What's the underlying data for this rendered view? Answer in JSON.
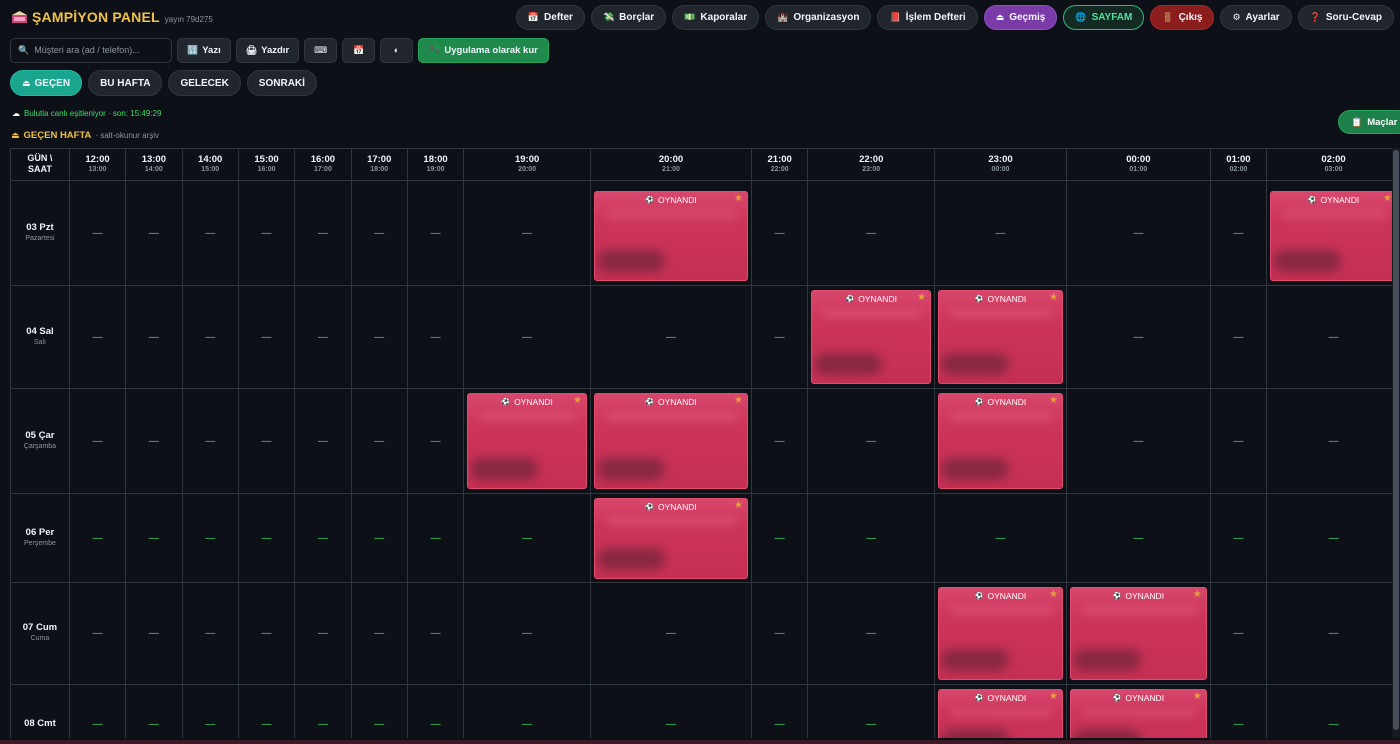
{
  "brand": {
    "title": "ŞAMPİYON PANEL",
    "version": "yayın 79d275"
  },
  "nav": [
    {
      "label": "Defter",
      "icon": "calendar-icon"
    },
    {
      "label": "Borçlar",
      "icon": "money-wings-icon"
    },
    {
      "label": "Kaporalar",
      "icon": "banknote-icon"
    },
    {
      "label": "Organizasyon",
      "icon": "castle-icon"
    },
    {
      "label": "İşlem Defteri",
      "icon": "notebook-icon"
    },
    {
      "label": "Geçmiş",
      "icon": "eject-icon",
      "accent": "#7a3aa8"
    },
    {
      "label": "SAYFAM",
      "icon": "globe-icon",
      "accent": "#2fb87a"
    },
    {
      "label": "Çıkış",
      "icon": "door-icon",
      "accent": "#8b1d1d"
    },
    {
      "label": "Ayarlar",
      "icon": "gear-icon"
    },
    {
      "label": "Soru-Cevap",
      "icon": "question-icon"
    }
  ],
  "toolbar": {
    "search_placeholder": "Müşteri ara (ad / telefon)...",
    "buttons": [
      {
        "label": "Yazı",
        "icon": "numbers-icon"
      },
      {
        "label": "Yazdır",
        "icon": "printer-icon"
      },
      {
        "label": "",
        "icon": "keyboard-icon"
      },
      {
        "label": "",
        "icon": "calendar-icon"
      },
      {
        "label": "",
        "icon": "theme-half-icon"
      }
    ],
    "install_label": "Uygulama olarak kur"
  },
  "week_tabs": [
    {
      "label": "GEÇEN",
      "icon": "eject-icon",
      "active": true
    },
    {
      "label": "BU HAFTA",
      "active": false
    },
    {
      "label": "GELECEK",
      "active": false
    },
    {
      "label": "SONRAKİ",
      "active": false
    }
  ],
  "sync_status": "Bulutla canlı eşitleniyor · son: 15:49:29",
  "archive": {
    "title": "GEÇEN HAFTA",
    "subtitle": "· salt-okunur arşiv"
  },
  "maclar_label": "Maçlar",
  "grid": {
    "corner": [
      "GÜN \\",
      "SAAT"
    ],
    "slots": [
      {
        "top": "12:00",
        "sub": "13:00"
      },
      {
        "top": "13:00",
        "sub": "14:00"
      },
      {
        "top": "14:00",
        "sub": "15:00"
      },
      {
        "top": "15:00",
        "sub": "16:00"
      },
      {
        "top": "16:00",
        "sub": "17:00"
      },
      {
        "top": "17:00",
        "sub": "18:00"
      },
      {
        "top": "18:00",
        "sub": "19:00"
      },
      {
        "top": "19:00",
        "sub": "20:00"
      },
      {
        "top": "20:00",
        "sub": "21:00"
      },
      {
        "top": "21:00",
        "sub": "22:00"
      },
      {
        "top": "22:00",
        "sub": "23:00"
      },
      {
        "top": "23:00",
        "sub": "00:00"
      },
      {
        "top": "00:00",
        "sub": "01:00"
      },
      {
        "top": "01:00",
        "sub": "02:00"
      },
      {
        "top": "02:00",
        "sub": "03:00"
      }
    ],
    "empty_mark": "—",
    "booking_status": "OYNANDI",
    "days": [
      {
        "name": "03 Pzt",
        "sub": "Pazartesi",
        "booked": [
          8,
          14
        ]
      },
      {
        "name": "04 Sal",
        "sub": "Salı",
        "booked": [
          10,
          11
        ]
      },
      {
        "name": "05 Çar",
        "sub": "Çarşamba",
        "booked": [
          7,
          8,
          11
        ]
      },
      {
        "name": "06 Per",
        "sub": "Perşembe",
        "booked": [
          8
        ]
      },
      {
        "name": "07 Cum",
        "sub": "Cuma",
        "booked": [
          11,
          12
        ]
      },
      {
        "name": "08 Cmt",
        "sub": "",
        "booked": [
          11,
          12
        ]
      }
    ]
  },
  "colors": {
    "booking": "#cb3358",
    "accent_gold": "#f0c14b",
    "dash": "#3fdc6a"
  }
}
